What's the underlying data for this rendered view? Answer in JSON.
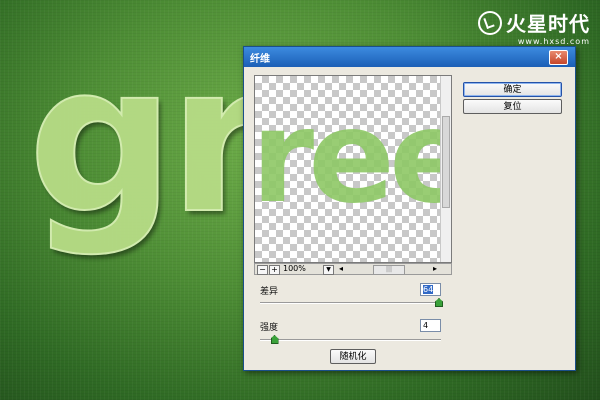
{
  "background": {
    "word": "gre"
  },
  "watermark": {
    "brand": "火星时代",
    "url": "www.hxsd.com"
  },
  "dialog": {
    "title": "纤维",
    "close_label": "×",
    "preview": {
      "word": "ree",
      "zoom": "100%",
      "zoom_out": "−",
      "zoom_in": "+",
      "zoom_dropdown": "▼",
      "scroll_left": "◂",
      "scroll_right": "▸",
      "scroll_grip": "|||"
    },
    "buttons": {
      "ok": "确定",
      "reset": "复位",
      "randomize": "随机化"
    },
    "variance": {
      "label": "差异",
      "value": "64",
      "level": 1.0
    },
    "strength": {
      "label": "强度",
      "value": "4",
      "level": 0.06
    }
  },
  "colors": {
    "titlebar": "#1b5fb6",
    "slider_thumb": "#3aa13a",
    "text_green": "#b7dc86"
  }
}
